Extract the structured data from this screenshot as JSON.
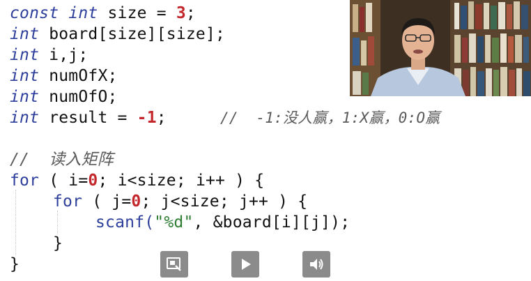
{
  "code": {
    "lines": {
      "l1": {
        "kw": "const int",
        "text": " size = ",
        "num": "3",
        "end": ";"
      },
      "l2": {
        "kw": "int",
        "text": " board[size][size];"
      },
      "l3": {
        "kw": "int",
        "text": " i,j;"
      },
      "l4": {
        "kw": "int",
        "text": " numOfX;"
      },
      "l5": {
        "kw": "int",
        "text": " numOfO;"
      },
      "l6": {
        "kw": "int",
        "text": " result = ",
        "num": "-1",
        "end": ";",
        "comment": "//  -1:没人赢，1:X赢，0:O赢"
      },
      "l7": {
        "comment": "//  读入矩阵"
      },
      "l8": {
        "kw": "for",
        "a": " ( i=",
        "num": "0",
        "b": "; i<size; i++ ) {"
      },
      "l9": {
        "kw": "for",
        "a": " ( j=",
        "num": "0",
        "b": "; j<size; j++ ) {"
      },
      "l10": {
        "fn": "scanf(",
        "str": "\"%d\"",
        "rest": ", &board[i][j]);"
      },
      "l11": {
        "text": "}"
      },
      "l12": {
        "text": "}"
      }
    }
  },
  "video": {
    "description_icon": "presenter-video-thumbnail"
  },
  "controls": {
    "exit_fullscreen_icon": "exit-fullscreen-icon",
    "play_icon": "play-icon",
    "volume_icon": "volume-icon"
  },
  "colors": {
    "keyword": "#2d3f9b",
    "number": "#c3272b",
    "comment": "#5a5a5a",
    "string": "#2e7d32",
    "control_bg": "#8b8b8b"
  }
}
